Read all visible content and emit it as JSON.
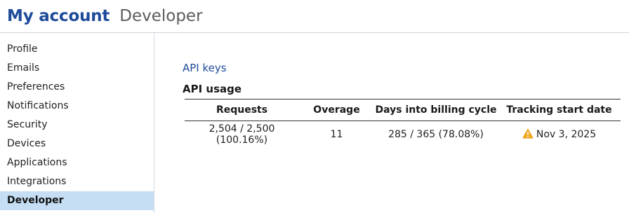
{
  "header": {
    "title": "My account",
    "subtitle": "Developer"
  },
  "sidebar": {
    "items": [
      {
        "label": "Profile",
        "active": false
      },
      {
        "label": "Emails",
        "active": false
      },
      {
        "label": "Preferences",
        "active": false
      },
      {
        "label": "Notifications",
        "active": false
      },
      {
        "label": "Security",
        "active": false
      },
      {
        "label": "Devices",
        "active": false
      },
      {
        "label": "Applications",
        "active": false
      },
      {
        "label": "Integrations",
        "active": false
      },
      {
        "label": "Developer",
        "active": true
      }
    ]
  },
  "main": {
    "api_keys_link": "API keys",
    "usage_title": "API usage",
    "table": {
      "headers": [
        "Requests",
        "Overage",
        "Days into billing cycle",
        "Tracking start date"
      ],
      "rows": [
        {
          "requests": "2,504 / 2,500 (100.16%)",
          "overage": "11",
          "days": "285 / 365 (78.08%)",
          "tracking_start": "Nov 3, 2025",
          "tracking_icon": "warning-icon"
        }
      ]
    }
  },
  "colors": {
    "brand": "#1e4a9a",
    "active_nav_bg": "#c5def3",
    "warning": "#f2a81d"
  }
}
